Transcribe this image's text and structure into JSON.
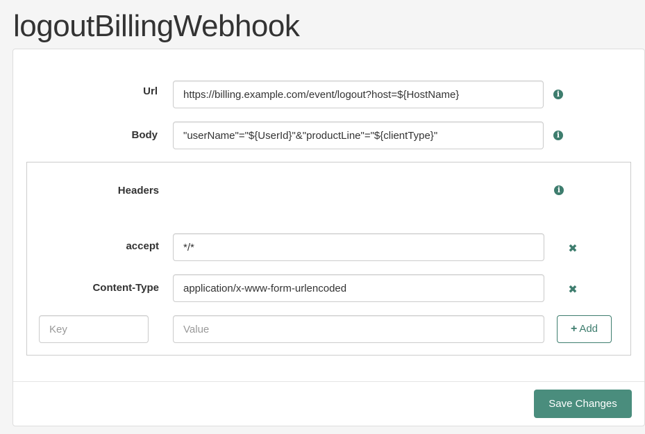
{
  "page": {
    "title": "logoutBillingWebhook"
  },
  "form": {
    "url": {
      "label": "Url",
      "value": "https://billing.example.com/event/logout?host=${HostName}",
      "info_icon": "info-icon"
    },
    "body": {
      "label": "Body",
      "value": "\"userName\"=\"${UserId}\"&\"productLine\"=\"${clientType}\"",
      "info_icon": "info-icon"
    },
    "headers": {
      "label": "Headers",
      "info_icon": "info-icon",
      "rows": [
        {
          "key": "accept",
          "value": "*/*",
          "remove_icon": "close-icon"
        },
        {
          "key": "Content-Type",
          "value": "application/x-www-form-urlencoded",
          "remove_icon": "close-icon"
        }
      ],
      "new_row": {
        "key_placeholder": "Key",
        "value_placeholder": "Value",
        "add_label": "Add",
        "add_icon": "plus-icon"
      }
    }
  },
  "footer": {
    "save_label": "Save Changes"
  },
  "colors": {
    "accent": "#4a8d7d",
    "icon": "#3e7d6e"
  }
}
